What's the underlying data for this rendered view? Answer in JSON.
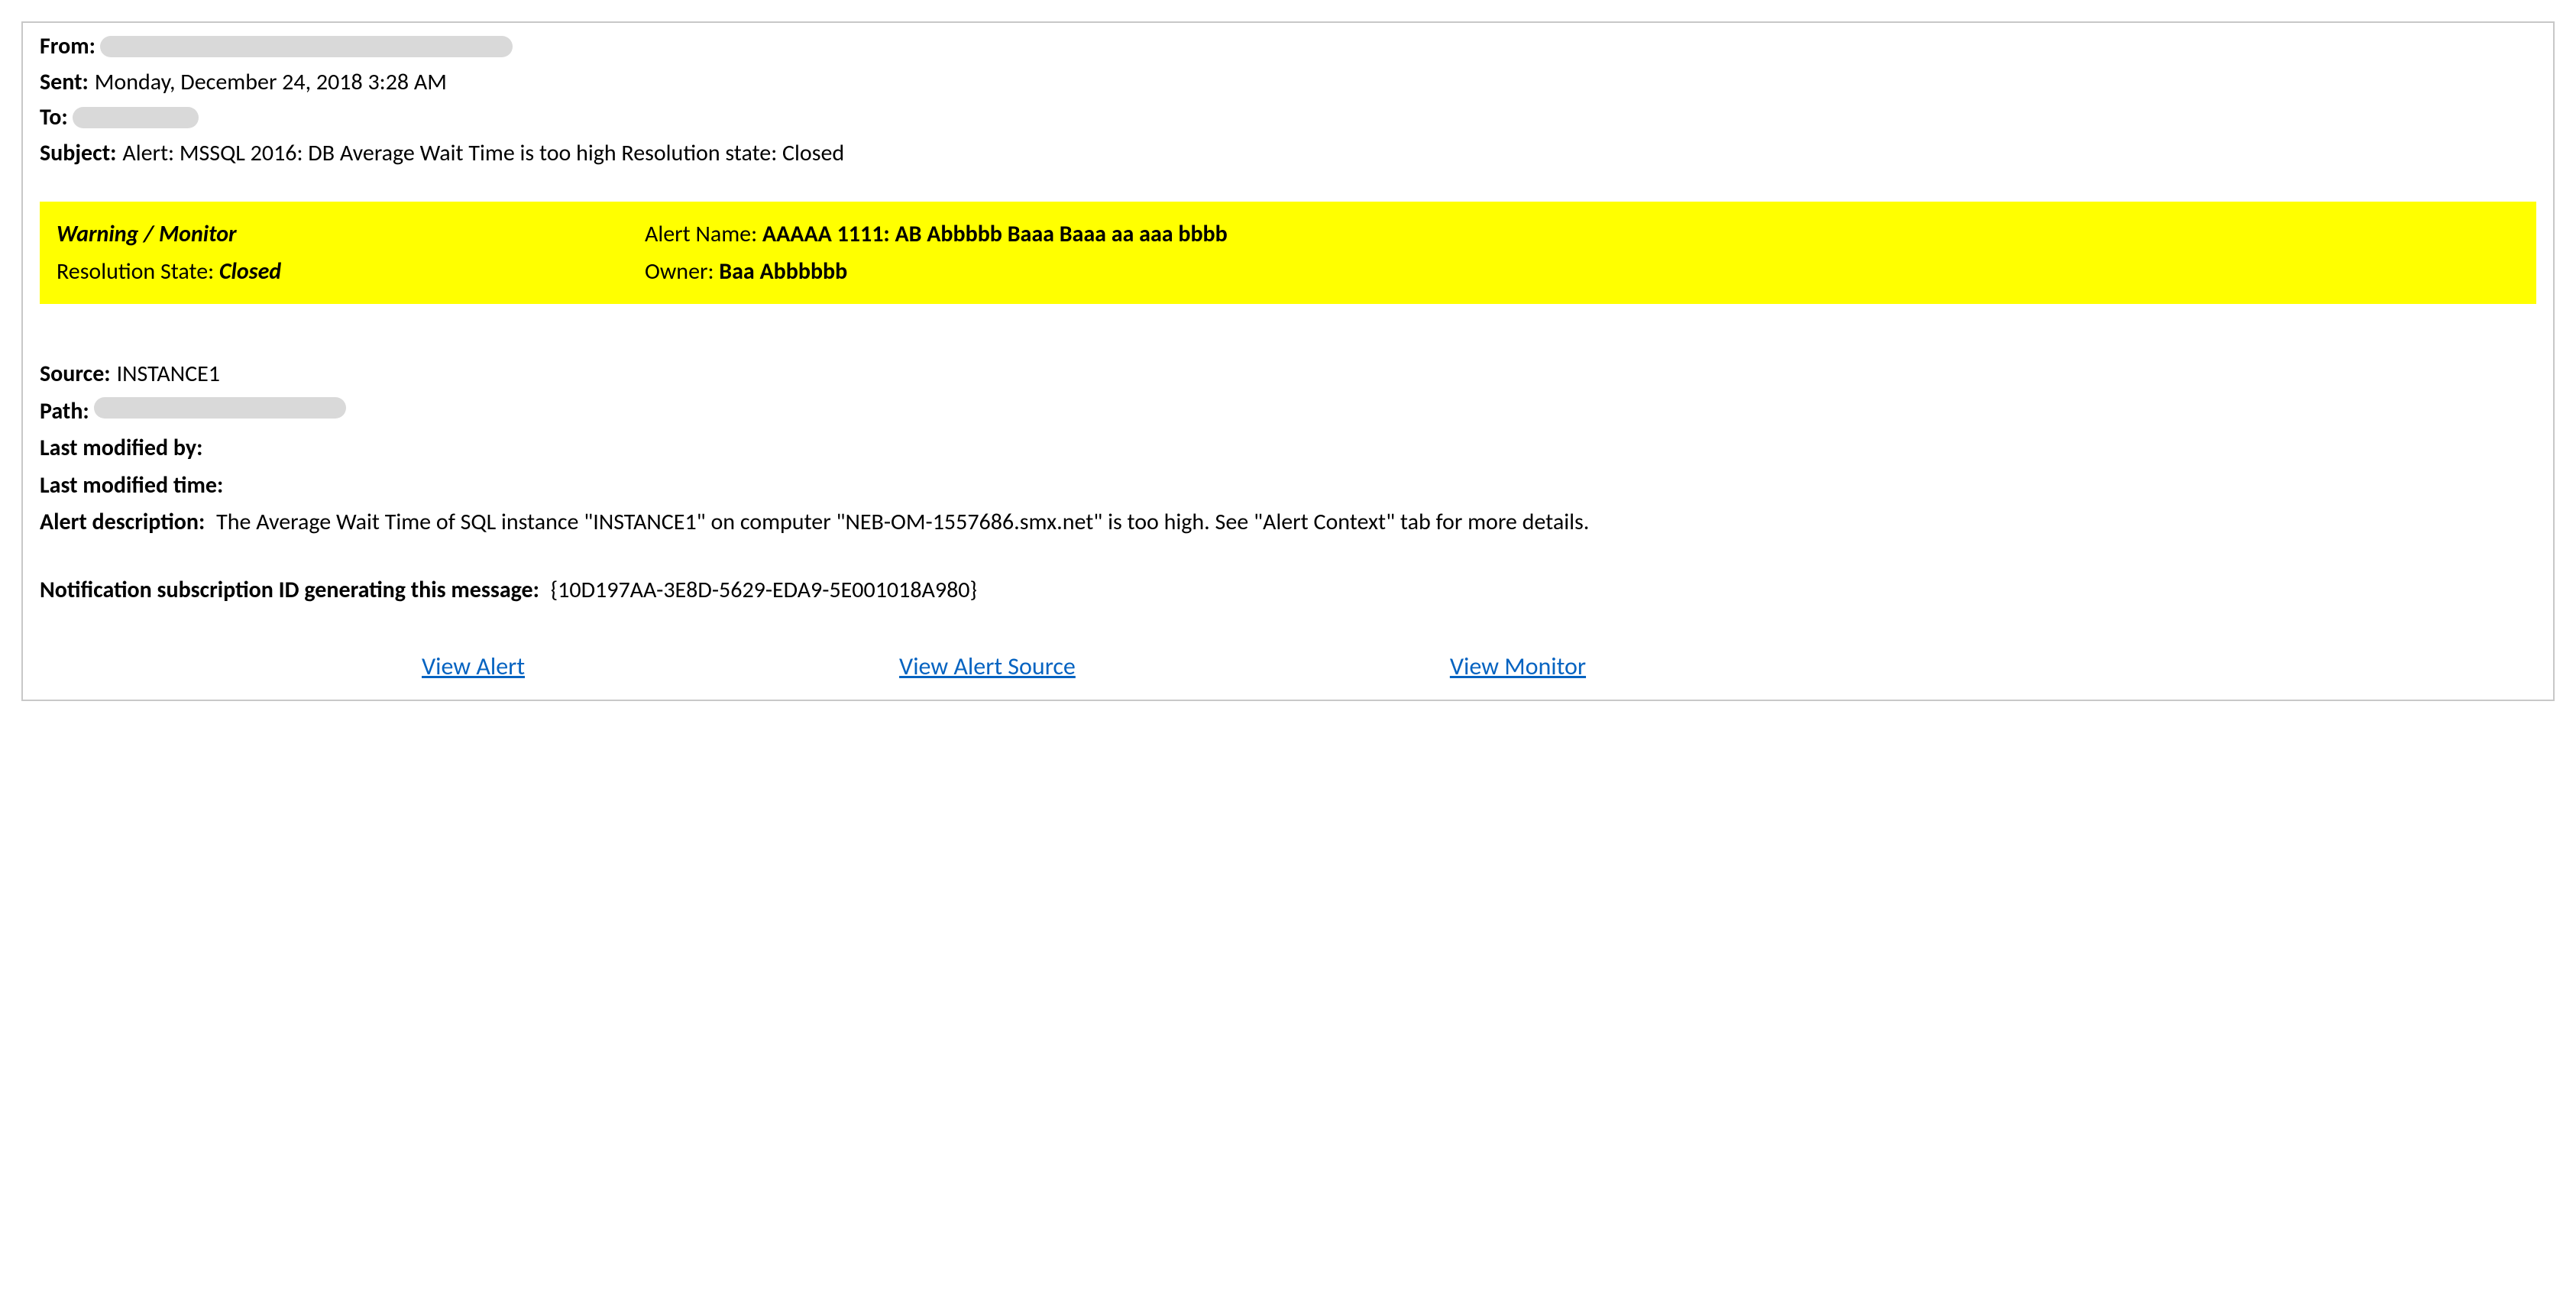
{
  "header": {
    "from_label": "From:",
    "from_value": "",
    "sent_label": "Sent:",
    "sent_value": "Monday, December 24, 2018 3:28 AM",
    "to_label": "To:",
    "to_value": "",
    "subject_label": "Subject:",
    "subject_value": "Alert: MSSQL 2016: DB Average Wait Time is too high Resolution state: Closed"
  },
  "highlight": {
    "warning_label": "Warning / Monitor",
    "alert_name_label": "Alert Name:  ",
    "alert_name_value": "AAAAA 1111: AB Abbbbb Baaa Baaa aa aaa bbbb",
    "resolution_state_label": "Resolution State: ",
    "resolution_state_value": "Closed",
    "owner_label": "Owner:  ",
    "owner_value": "Baa Abbbbbb"
  },
  "details": {
    "source_label": "Source:",
    "source_value": "INSTANCE1",
    "path_label": "Path:",
    "path_value": "",
    "last_modified_by_label": "Last modified by:",
    "last_modified_by_value": "",
    "last_modified_time_label": "Last modified time:",
    "last_modified_time_value": "",
    "alert_description_label": "Alert description:",
    "alert_description_value": "The Average Wait Time of SQL instance \"INSTANCE1\" on computer \"NEB-OM-1557686.smx.net\" is too high. See \"Alert Context\" tab for more details.",
    "subscription_label": "Notification subscription ID generating this message:",
    "subscription_value": "{10D197AA-3E8D-5629-EDA9-5E001018A980}"
  },
  "links": {
    "view_alert": "View Alert",
    "view_alert_source": "View Alert Source",
    "view_monitor": "View Monitor"
  }
}
